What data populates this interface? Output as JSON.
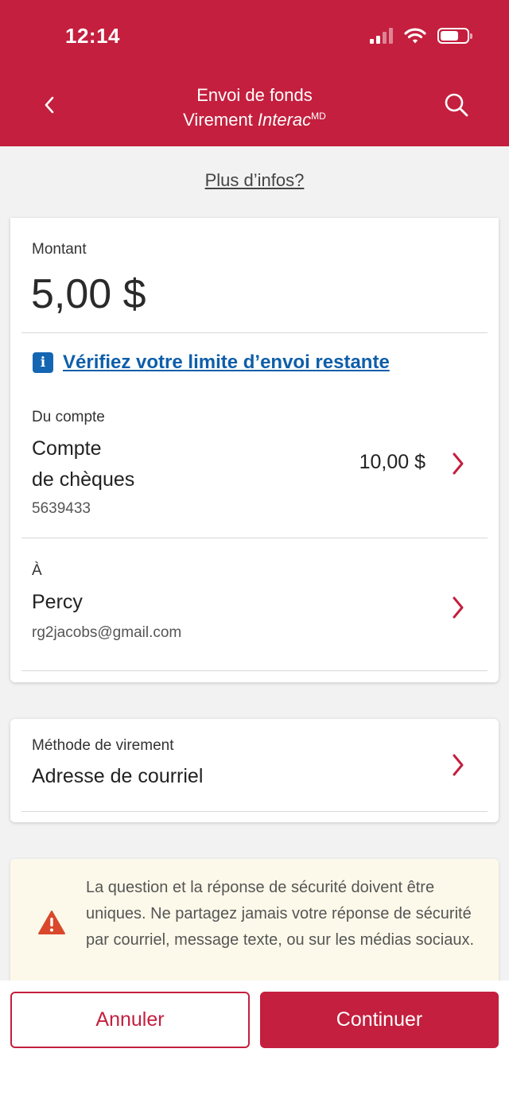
{
  "status_bar": {
    "time": "12:14"
  },
  "header": {
    "title_line1": "Envoi de fonds",
    "title_line2_prefix": "Virement ",
    "title_line2_brand": "Interac",
    "title_line2_mark": "MD",
    "back_icon": "chevron-left-icon",
    "search_icon": "search-icon"
  },
  "more_info": {
    "label": "Plus d’infos?"
  },
  "amount": {
    "label": "Montant",
    "value": "5,00 $"
  },
  "limit_link": {
    "label": "Vérifiez votre limite d’envoi restante",
    "icon": "info-icon"
  },
  "from_account": {
    "label": "Du compte",
    "name_line1": "Compte",
    "name_line2": "de chèques",
    "number": "5639433",
    "balance": "10,00 $"
  },
  "recipient": {
    "label": "À",
    "name": "Percy",
    "email": "rg2jacobs@gmail.com"
  },
  "transfer_method": {
    "label": "Méthode de virement",
    "value": "Adresse de courriel"
  },
  "warning": {
    "text": "La question et la réponse de sécurité doivent être uniques. Ne partagez jamais votre réponse de sécurité par courriel, message texte, ou sur les médias sociaux."
  },
  "footer": {
    "cancel_label": "Annuler",
    "continue_label": "Continuer"
  },
  "colors": {
    "brand": "#c41f3e",
    "link": "#0e5ea9",
    "warning_bg": "#fdf9ea",
    "warning_icon": "#d9482b"
  }
}
